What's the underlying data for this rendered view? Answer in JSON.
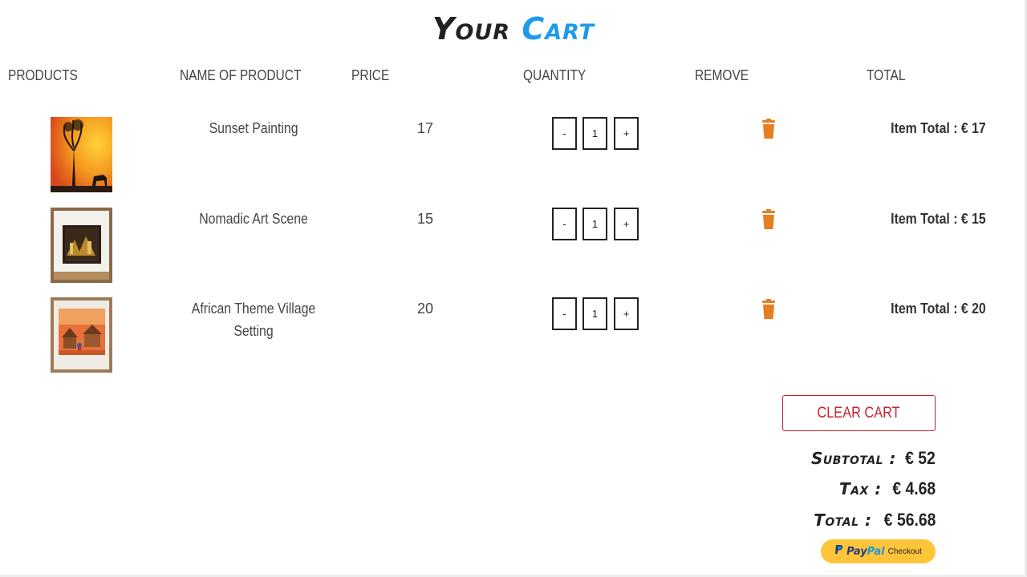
{
  "title": {
    "word1": "Your",
    "word2": "Cart"
  },
  "columns": {
    "products": "PRODUCTS",
    "name": "NAME OF PRODUCT",
    "price": "PRICE",
    "quantity": "QUANTITY",
    "remove": "REMOVE",
    "total": "TOTAL"
  },
  "items": [
    {
      "name": "Sunset Painting",
      "price": "17",
      "quantity": "1",
      "total": "Item Total : € 17",
      "image": "sunset-tree-painting"
    },
    {
      "name": "Nomadic Art Scene",
      "price": "15",
      "quantity": "1",
      "total": "Item Total : € 15",
      "image": "nomadic-art-framed"
    },
    {
      "name": "African Theme Village Setting",
      "price": "20",
      "quantity": "1",
      "total": "Item Total : € 20",
      "image": "african-village-framed"
    }
  ],
  "qty_controls": {
    "minus": "-",
    "plus": "+"
  },
  "clear_cart": "CLEAR CART",
  "summary": {
    "subtotal_label": "Subtotal :",
    "subtotal_value": "€ 52",
    "tax_label": "Tax :",
    "tax_value": "€ 4.68",
    "total_label": "Total :",
    "total_value": "€ 56.68"
  },
  "paypal": {
    "brand_pay": "Pay",
    "brand_pal": "Pal",
    "label": "Checkout"
  },
  "colors": {
    "accent_blue": "#1e9be8",
    "trash_orange": "#e67e22",
    "clear_red": "#c8242f",
    "paypal_yellow": "#ffc439"
  }
}
